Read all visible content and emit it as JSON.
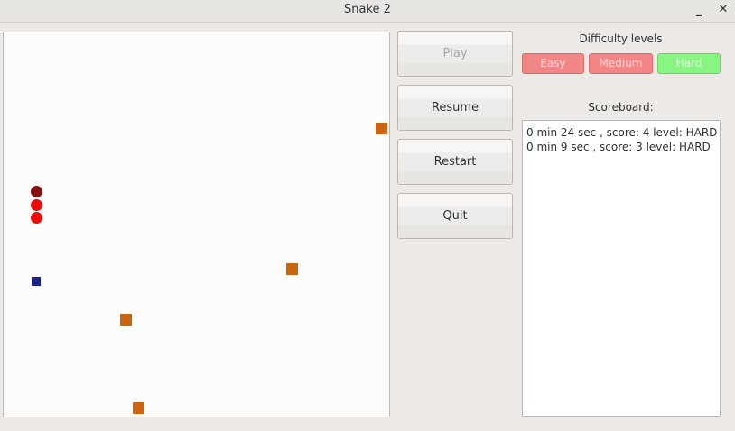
{
  "window": {
    "title": "Snake 2",
    "minimize_glyph": "_",
    "close_glyph": "✕"
  },
  "controls": {
    "play_label": "Play",
    "resume_label": "Resume",
    "restart_label": "Restart",
    "quit_label": "Quit"
  },
  "difficulty": {
    "title": "Difficulty levels",
    "easy_label": "Easy",
    "medium_label": "Medium",
    "hard_label": "Hard",
    "selected": "Hard"
  },
  "scoreboard": {
    "title": "Scoreboard:",
    "entries": [
      "0 min 24 sec , score: 4 level: HARD",
      "0 min 9 sec , score: 3 level: HARD"
    ]
  },
  "colors": {
    "food": "#cc6410",
    "snake_body": "#ef0a0a",
    "snake_head": "#8a1010",
    "bonus": "#1c2288",
    "difficulty_inactive": "#f28686",
    "difficulty_active": "#88f582"
  }
}
